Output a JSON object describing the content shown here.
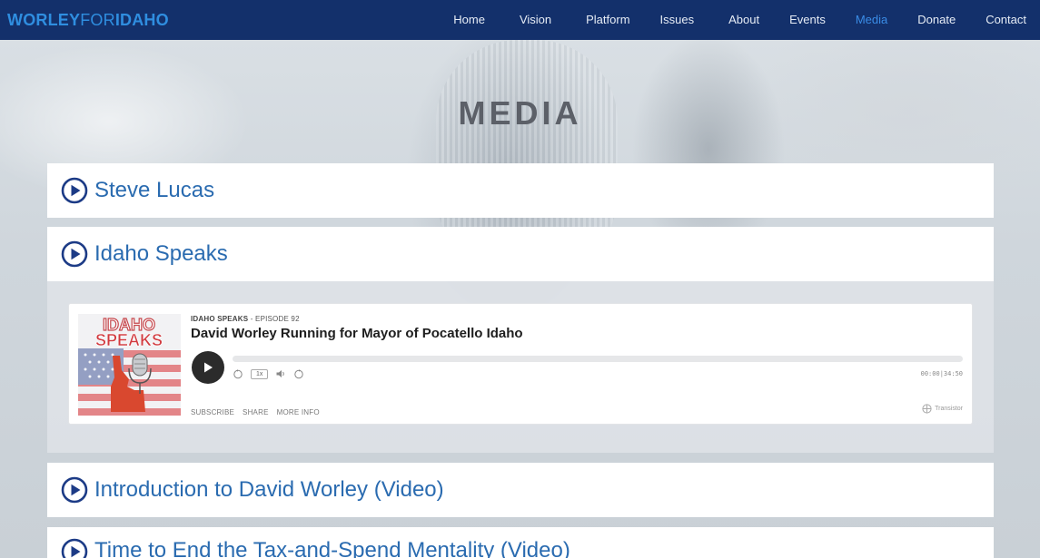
{
  "brand": {
    "part1": "WORLEY",
    "part2": "FOR",
    "part3": "IDAHO"
  },
  "nav": {
    "items": [
      {
        "label": "Home"
      },
      {
        "label": "Vision"
      },
      {
        "label": "Platform"
      },
      {
        "label": "Issues"
      },
      {
        "label": "About"
      },
      {
        "label": "Events"
      },
      {
        "label": "Media",
        "active": true
      },
      {
        "label": "Donate"
      },
      {
        "label": "Contact"
      }
    ]
  },
  "page": {
    "title": "MEDIA"
  },
  "accordion": [
    {
      "title": "Steve Lucas",
      "expanded": false,
      "icon": "play-circle-icon"
    },
    {
      "title": "Idaho Speaks",
      "expanded": true,
      "icon": "play-circle-icon"
    },
    {
      "title": "Introduction to David Worley (Video)",
      "expanded": false,
      "icon": "play-circle-icon"
    },
    {
      "title": "Time to End the Tax-and-Spend Mentality (Video)",
      "expanded": false,
      "icon": "play-circle-icon"
    }
  ],
  "player": {
    "show": "IDAHO SPEAKS",
    "separator": " - ",
    "episode": "EPISODE 92",
    "title": "David Worley Running for Mayor of Pocatello Idaho",
    "speed": "1x",
    "time_current": "00:00",
    "time_total": "34:50",
    "links": {
      "subscribe": "SUBSCRIBE",
      "share": "SHARE",
      "more_info": "MORE INFO"
    },
    "powered_by": "Transistor",
    "cover_text": {
      "line1": "IDAHO",
      "line2": "SPEAKS"
    }
  },
  "colors": {
    "navbar_bg": "#13306b",
    "brand": "#2f8ee0",
    "nav_active": "#3a8ce6",
    "accordion_title": "#2a6bb0",
    "icon": "#1c3b86"
  }
}
